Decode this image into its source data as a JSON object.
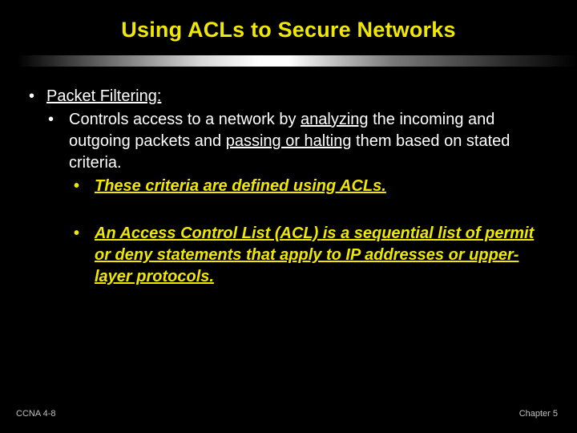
{
  "title": "Using ACLs to Secure Networks",
  "bullet1": "Packet Filtering:",
  "bullet2": {
    "s1": "Controls access to a network by ",
    "u1": "analyzing",
    "s2": " the incoming and outgoing packets and ",
    "u2": "passing or halting",
    "s3": " them based on stated criteria."
  },
  "bullet3a": "These criteria are defined using ACLs.",
  "bullet3b": "An Access Control List (ACL) is a sequential list of permit or deny statements that apply to IP addresses or upper-layer protocols.",
  "footer": {
    "left": "CCNA 4-8",
    "right": "Chapter 5"
  }
}
